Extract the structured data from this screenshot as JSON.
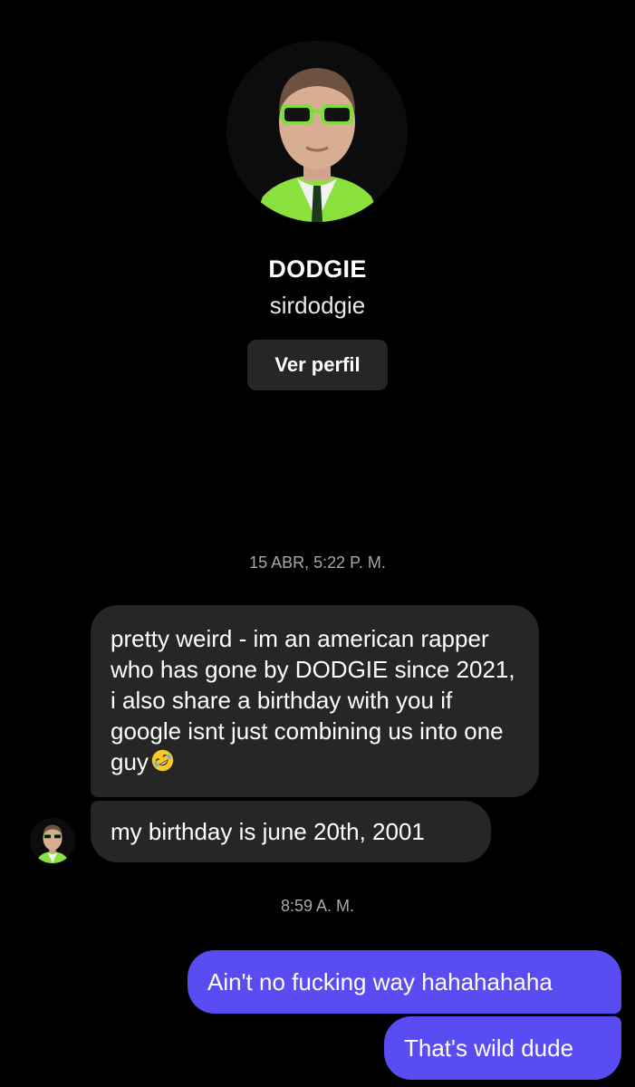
{
  "profile": {
    "name": "DODGIE",
    "username": "sirdodgie",
    "view_profile_label": "Ver perfil"
  },
  "conversation": {
    "timestamps": [
      "15 ABR, 5:22 P. M.",
      "8:59 A. M."
    ],
    "incoming": [
      {
        "text": "pretty weird - im an american rapper who has gone by DODGIE since 2021, i also share a birthday with you if google isnt just combining us into one guy",
        "emoji": "rolling-on-floor-laughing-emoji"
      },
      {
        "text": "my birthday is june 20th, 2001"
      }
    ],
    "outgoing": [
      {
        "text": "Ain't no fucking way hahahahaha"
      },
      {
        "text": "That's wild dude"
      }
    ]
  },
  "colors": {
    "background": "#000000",
    "incoming_bubble": "#262626",
    "outgoing_bubble": "#5a4cf3",
    "button_bg": "#262626",
    "timestamp_text": "#a8a8a8",
    "accent_green": "#7de03a"
  }
}
